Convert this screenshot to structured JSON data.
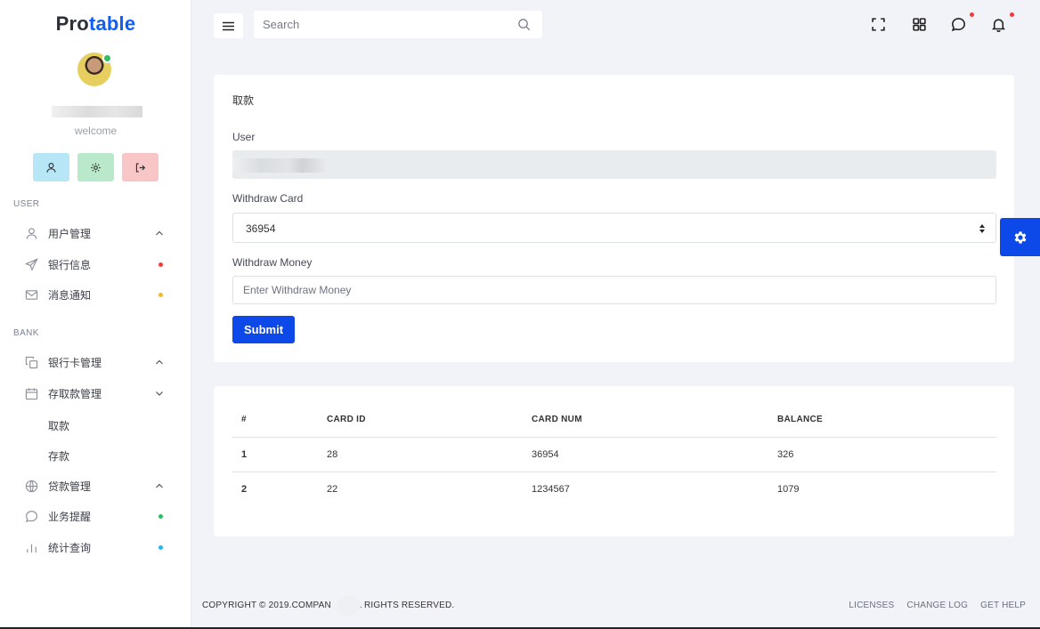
{
  "brand": {
    "prefix": "Pro",
    "accent": "table"
  },
  "profile": {
    "welcome": "welcome"
  },
  "sidebar": {
    "user_section": "USER",
    "bank_section": "BANK",
    "items": [
      {
        "label": "用户管理"
      },
      {
        "label": "银行信息"
      },
      {
        "label": "消息通知"
      },
      {
        "label": "银行卡管理"
      },
      {
        "label": "存取款管理"
      },
      {
        "label": "贷款管理"
      },
      {
        "label": "业务提醒"
      },
      {
        "label": "统计查询"
      }
    ],
    "subitems": [
      {
        "label": "取款"
      },
      {
        "label": "存款"
      }
    ]
  },
  "topbar": {
    "search_placeholder": "Search"
  },
  "form": {
    "title": "取款",
    "user_label": "User",
    "card_label": "Withdraw Card",
    "card_value": "36954",
    "money_label": "Withdraw Money",
    "money_placeholder": "Enter Withdraw Money",
    "submit": "Submit"
  },
  "table": {
    "headers": [
      "#",
      "CARD ID",
      "CARD NUM",
      "BALANCE"
    ],
    "rows": [
      [
        "1",
        "28",
        "36954",
        "326"
      ],
      [
        "2",
        "22",
        "1234567",
        "1079"
      ]
    ]
  },
  "footer": {
    "copyright_a": "COPYRIGHT © 2019.COMPAN",
    "copyright_b": "ALL RIGHTS RESERVED.",
    "links": [
      "LICENSES",
      "CHANGE LOG",
      "GET HELP"
    ]
  },
  "colors": {
    "primary": "#0d48e8",
    "brand_accent": "#0d5ef7",
    "dot_red": "#f23c3c",
    "dot_yellow": "#f5b82e",
    "dot_green": "#2fbe5f",
    "dot_cyan": "#22b8e8"
  }
}
